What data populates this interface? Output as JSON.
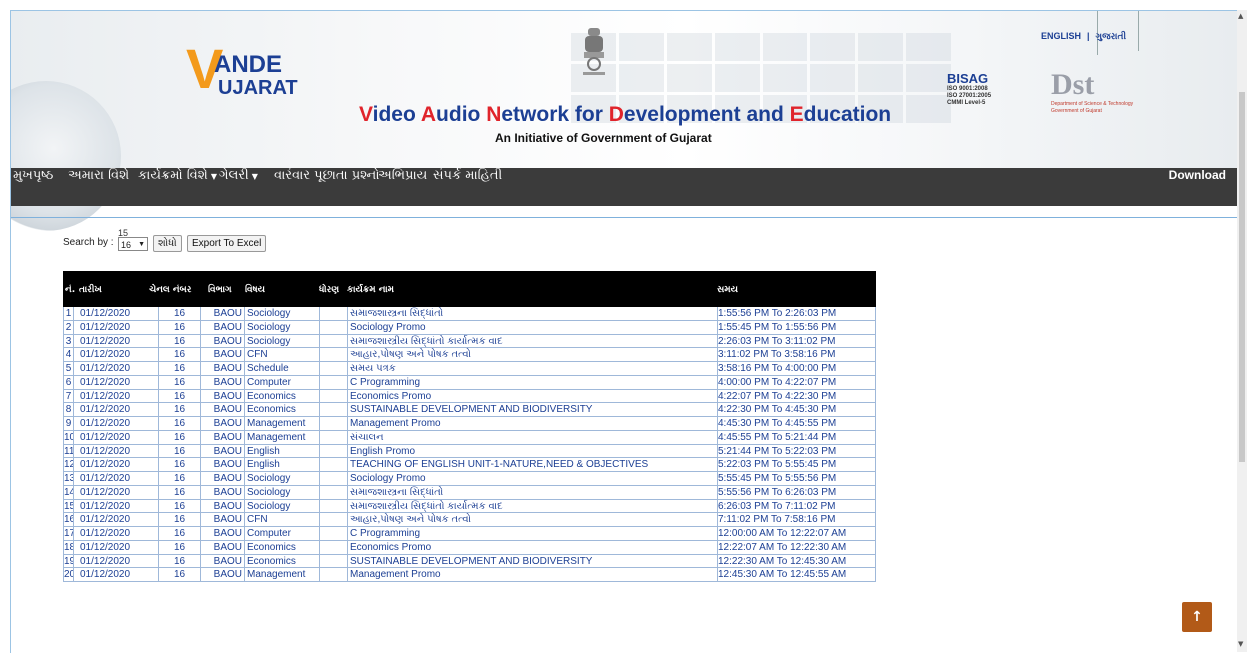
{
  "header": {
    "logo_v": "V",
    "logo_ande": "ANDE",
    "logo_ujarat": "UJARAT",
    "title_parts": [
      "V",
      "ideo ",
      "A",
      "udio ",
      "N",
      "etwork for ",
      "D",
      "evelopment and ",
      "E",
      "ducation"
    ],
    "subtitle": "An Initiative of Government of Gujarat",
    "bisag_name": "BISAG",
    "bisag_lines": [
      "ISO 9001:2008",
      "ISO 27001:2005",
      "CMMI Level-5"
    ],
    "dst_name": "Dst",
    "dst_lines": [
      "Department of Science & Technology",
      "Government of Gujarat"
    ],
    "lang_english": "ENGLISH",
    "lang_sep": "|",
    "lang_gujarati": "ગુજરાતી"
  },
  "nav": {
    "items": [
      {
        "label": "મુખપૃષ્ઠ",
        "caret": false
      },
      {
        "label": "અમારા વિશે",
        "caret": false
      },
      {
        "label": "કાર્યક્રમો વિશે",
        "caret": true
      },
      {
        "label": "ગેલરી",
        "caret": true
      },
      {
        "label": "વારંવાર પૂછાતા પ્રશ્નો",
        "caret": false
      },
      {
        "label": "અભિપ્રાય",
        "caret": false
      },
      {
        "label": "સંપર્ક માહિતી",
        "caret": false
      }
    ],
    "download": "Download"
  },
  "search": {
    "label": "Search by :",
    "option_above": "15",
    "selected": "16",
    "search_button": "શોધો",
    "export_button": "Export To Excel"
  },
  "table": {
    "headers": [
      "નં.",
      "તારીખ",
      "ચેનલ નંબર",
      "વિભાગ",
      "વિષય",
      "ધોરણ",
      "કાર્યક્રમ નામ",
      "સમય"
    ],
    "rows": [
      [
        "1",
        "01/12/2020",
        "16",
        "BAOU",
        "Sociology",
        "",
        "સમાજશાસ્ત્રના સિદ્ધાંતો",
        "1:55:56 PM To 2:26:03 PM"
      ],
      [
        "2",
        "01/12/2020",
        "16",
        "BAOU",
        "Sociology",
        "",
        "Sociology Promo",
        "1:55:45 PM To 1:55:56 PM"
      ],
      [
        "3",
        "01/12/2020",
        "16",
        "BAOU",
        "Sociology",
        "",
        "સમાજશાસ્ત્રીય સિદ્ધાંતો કાર્યાત્મક વાદ",
        "2:26:03 PM To 3:11:02 PM"
      ],
      [
        "4",
        "01/12/2020",
        "16",
        "BAOU",
        "CFN",
        "",
        "આહાર,પોષણ અને પોષક તત્વો",
        "3:11:02 PM To 3:58:16 PM"
      ],
      [
        "5",
        "01/12/2020",
        "16",
        "BAOU",
        "Schedule",
        "",
        "સમય પત્રક",
        "3:58:16 PM To 4:00:00 PM"
      ],
      [
        "6",
        "01/12/2020",
        "16",
        "BAOU",
        "Computer",
        "",
        "C Programming",
        "4:00:00 PM To 4:22:07 PM"
      ],
      [
        "7",
        "01/12/2020",
        "16",
        "BAOU",
        "Economics",
        "",
        "Economics Promo",
        "4:22:07 PM To 4:22:30 PM"
      ],
      [
        "8",
        "01/12/2020",
        "16",
        "BAOU",
        "Economics",
        "",
        "SUSTAINABLE DEVELOPMENT AND BIODIVERSITY",
        "4:22:30 PM To 4:45:30 PM"
      ],
      [
        "9",
        "01/12/2020",
        "16",
        "BAOU",
        "Management",
        "",
        "Management Promo",
        "4:45:30 PM To 4:45:55 PM"
      ],
      [
        "10",
        "01/12/2020",
        "16",
        "BAOU",
        "Management",
        "",
        "સંચાલન",
        "4:45:55 PM To 5:21:44 PM"
      ],
      [
        "11",
        "01/12/2020",
        "16",
        "BAOU",
        "English",
        "",
        "English Promo",
        "5:21:44 PM To 5:22:03 PM"
      ],
      [
        "12",
        "01/12/2020",
        "16",
        "BAOU",
        "English",
        "",
        "TEACHING OF ENGLISH UNIT-1-NATURE,NEED & OBJECTIVES",
        "5:22:03 PM To 5:55:45 PM"
      ],
      [
        "13",
        "01/12/2020",
        "16",
        "BAOU",
        "Sociology",
        "",
        "Sociology Promo",
        "5:55:45 PM To 5:55:56 PM"
      ],
      [
        "14",
        "01/12/2020",
        "16",
        "BAOU",
        "Sociology",
        "",
        "સમાજશાસ્ત્રના સિદ્ધાંતો",
        "5:55:56 PM To 6:26:03 PM"
      ],
      [
        "15",
        "01/12/2020",
        "16",
        "BAOU",
        "Sociology",
        "",
        "સમાજશાસ્ત્રીય સિદ્ધાંતો કાર્યાત્મક વાદ",
        "6:26:03 PM To 7:11:02 PM"
      ],
      [
        "16",
        "01/12/2020",
        "16",
        "BAOU",
        "CFN",
        "",
        "આહાર,પોષણ અને પોષક તત્વો",
        "7:11:02 PM To 7:58:16 PM"
      ],
      [
        "17",
        "01/12/2020",
        "16",
        "BAOU",
        "Computer",
        "",
        "C Programming",
        "12:00:00 AM To 12:22:07 AM"
      ],
      [
        "18",
        "01/12/2020",
        "16",
        "BAOU",
        "Economics",
        "",
        "Economics Promo",
        "12:22:07 AM To 12:22:30 AM"
      ],
      [
        "19",
        "01/12/2020",
        "16",
        "BAOU",
        "Economics",
        "",
        "SUSTAINABLE DEVELOPMENT AND BIODIVERSITY",
        "12:22:30 AM To 12:45:30 AM"
      ],
      [
        "20",
        "01/12/2020",
        "16",
        "BAOU",
        "Management",
        "",
        "Management Promo",
        "12:45:30 AM To 12:45:55 AM"
      ]
    ]
  },
  "controls": {
    "back_to_top_icon": "arrow-up-icon",
    "back_to_top_glyph": "↑",
    "scroll_up_glyph": "▲",
    "scroll_down_glyph": "▼"
  },
  "colors": {
    "brand_blue": "#1c3f94",
    "brand_red": "#e0242b",
    "brand_orange": "#f39a1c",
    "nav_bg": "#3b3b3b",
    "back_to_top": "#b25a18"
  }
}
